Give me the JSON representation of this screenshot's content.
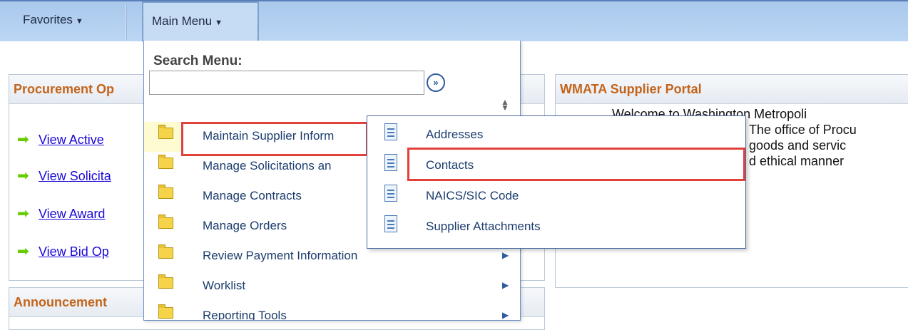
{
  "nav": {
    "favorites": "Favorites",
    "main_menu": "Main Menu"
  },
  "left_pagelet": {
    "title": "Procurement Op",
    "links": [
      "View Active",
      "View Solicita",
      "View Award",
      "View Bid Op"
    ]
  },
  "announcements": {
    "title": "Announcement"
  },
  "right_pagelet": {
    "title": "WMATA Supplier Portal",
    "lines": [
      "Welcome to Washington Metropoli",
      "The office of Procu",
      "goods and servic",
      "d   ethical   manner"
    ]
  },
  "menu": {
    "search_label": "Search Menu:",
    "search_value": "",
    "items": [
      "Maintain Supplier Inform",
      "Manage Solicitations an",
      "Manage Contracts",
      "Manage Orders",
      "Review Payment Information",
      "Worklist",
      "Reporting Tools"
    ]
  },
  "submenu": {
    "items": [
      "Addresses",
      "Contacts",
      "NAICS/SIC Code",
      "Supplier Attachments"
    ]
  },
  "colors": {
    "highlight": "#e2403b",
    "pagelet_title": "#c3641b",
    "link": "#1a0ad8",
    "menu_text": "#1c3d6e"
  }
}
